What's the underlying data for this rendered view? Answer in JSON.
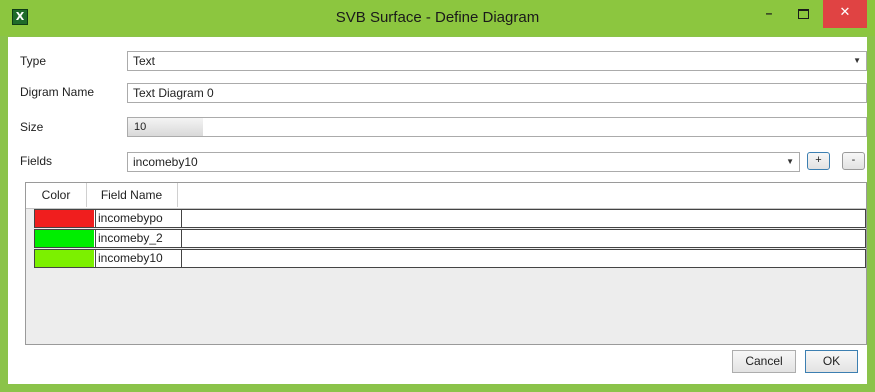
{
  "window": {
    "title": "SVB Surface - Define Diagram",
    "icon_glyph": "X",
    "minimize_label": "–",
    "close_label": "✕"
  },
  "form": {
    "type_label": "Type",
    "type_value": "Text",
    "name_label": "Digram Name",
    "name_value": "Text Diagram 0",
    "size_label": "Size",
    "size_value": "10",
    "fields_label": "Fields",
    "fields_value": "incomeby10",
    "add_label": "+",
    "remove_label": "-"
  },
  "table": {
    "headers": {
      "color": "Color",
      "field_name": "Field Name"
    },
    "rows": [
      {
        "color": "#f01e1e",
        "field_name": "incomebypo"
      },
      {
        "color": "#00ee00",
        "field_name": "incomeby_2"
      },
      {
        "color": "#7cf000",
        "field_name": "incomeby10"
      }
    ]
  },
  "buttons": {
    "cancel": "Cancel",
    "ok": "OK"
  }
}
